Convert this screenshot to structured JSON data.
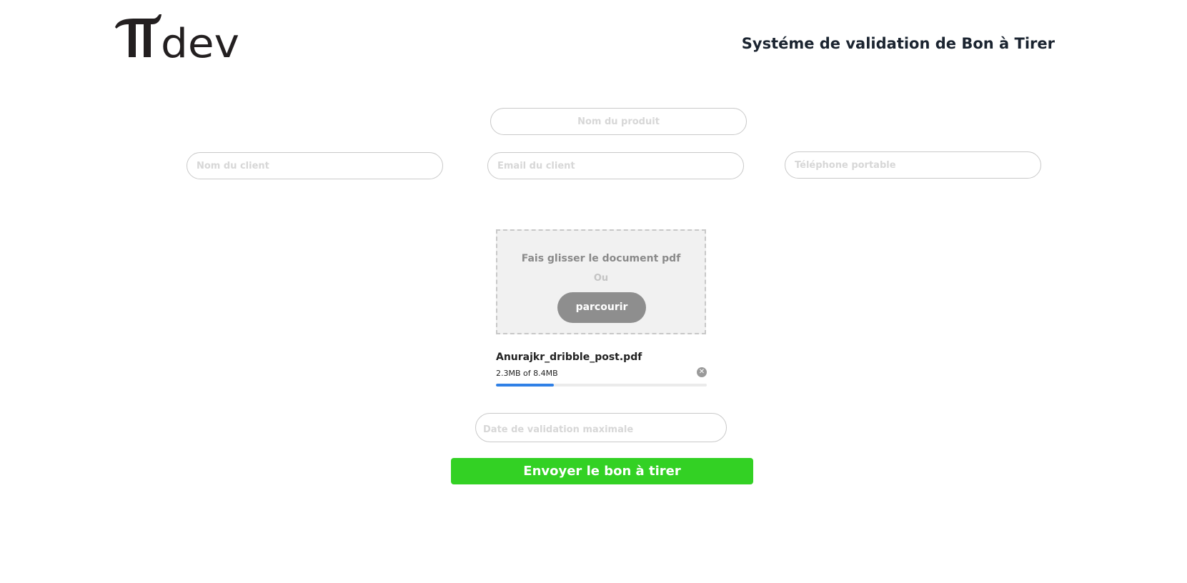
{
  "header": {
    "logo_text": "dev",
    "title": "Systéme de validation de Bon à Tirer"
  },
  "form": {
    "product_name": {
      "placeholder": "Nom du produit",
      "value": ""
    },
    "client_name": {
      "placeholder": "Nom du client",
      "value": ""
    },
    "client_email": {
      "placeholder": "Email du client",
      "value": ""
    },
    "mobile_phone": {
      "placeholder": "Téléphone portable",
      "value": ""
    },
    "validation_date": {
      "placeholder": "Date de validation maximale",
      "value": ""
    }
  },
  "upload": {
    "drop_text": "Fais glisser le document pdf",
    "or_text": "Ou",
    "browse_label": "parcourir",
    "file": {
      "name": "Anurajkr_dribble_post.pdf",
      "size_text": "2.3MB of 8.4MB",
      "uploaded_mb": 2.3,
      "total_mb": 8.4
    }
  },
  "submit_label": "Envoyer le bon à tirer",
  "colors": {
    "title": "#1b2430",
    "submit": "#33d124",
    "progress": "#2f80e6",
    "browse_button": "#8e8e8e",
    "dropzone_bg": "#f1f1f1"
  },
  "icons": {
    "remove_file": "close-circle-icon"
  }
}
